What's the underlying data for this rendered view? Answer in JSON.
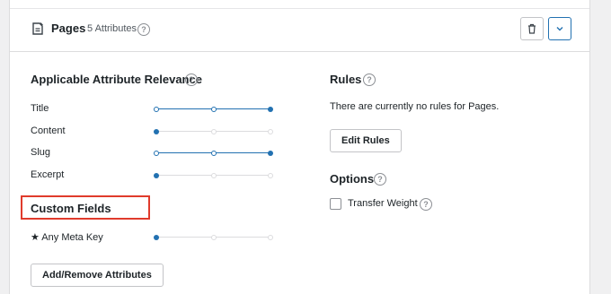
{
  "header": {
    "title": "Pages",
    "count": "5 Attributes"
  },
  "relevance": {
    "title": "Applicable Attribute Relevance",
    "attributes": [
      {
        "label": "Title",
        "level": 3
      },
      {
        "label": "Content",
        "level": 1
      },
      {
        "label": "Slug",
        "level": 3
      },
      {
        "label": "Excerpt",
        "level": 1
      }
    ]
  },
  "custom_fields": {
    "title": "Custom Fields",
    "items": [
      {
        "label": "★ Any Meta Key",
        "level": 1
      }
    ]
  },
  "add_remove_label": "Add/Remove Attributes",
  "rules": {
    "title": "Rules",
    "empty_text": "There are currently no rules for Pages.",
    "edit_label": "Edit Rules"
  },
  "options": {
    "title": "Options",
    "transfer_weight_label": "Transfer Weight",
    "transfer_weight_checked": false
  },
  "colors": {
    "accent": "#2271b1",
    "highlight_border": "#e03b2c"
  }
}
